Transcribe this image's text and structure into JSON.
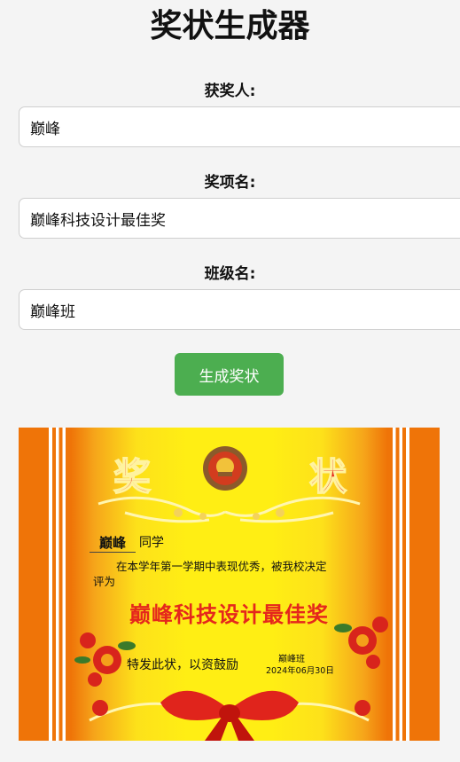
{
  "page": {
    "title": "奖状生成器"
  },
  "form": {
    "recipient_label": "获奖人:",
    "recipient_value": "巅峰",
    "award_label": "奖项名:",
    "award_value": "巅峰科技设计最佳奖",
    "class_label": "班级名:",
    "class_value": "巅峰班",
    "generate_button": "生成奖状"
  },
  "certificate": {
    "heading_left": "奖",
    "heading_right": "状",
    "recipient": "巅峰",
    "suffix": "同学",
    "body_line1": "在本学年第一学期中表现优秀，被我校决定",
    "body_line2": "评为",
    "award": "巅峰科技设计最佳奖",
    "closing": "特发此状，以资鼓励",
    "class_name": "巅峰班",
    "date": "2024年06月30日"
  },
  "colors": {
    "button": "#4cae50",
    "border_orange": "#ef7408",
    "certificate_yellow": "#ffee14",
    "award_red": "#e5271c"
  }
}
